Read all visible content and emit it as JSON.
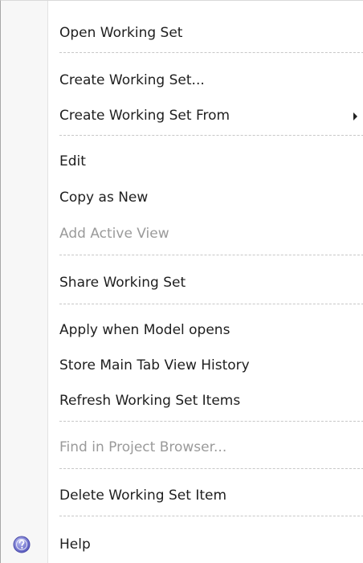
{
  "context_menu": {
    "items": [
      {
        "label": "Open Working Set"
      },
      {
        "label": "Create Working Set..."
      },
      {
        "label": "Create Working Set From"
      },
      {
        "label": "Edit"
      },
      {
        "label": "Copy as New"
      },
      {
        "label": "Add Active View"
      },
      {
        "label": "Share Working Set"
      },
      {
        "label": "Apply when Model opens"
      },
      {
        "label": "Store Main Tab View History"
      },
      {
        "label": "Refresh Working Set Items"
      },
      {
        "label": "Find in Project Browser..."
      },
      {
        "label": "Delete Working Set Item"
      },
      {
        "label": "Help"
      }
    ],
    "icons": {
      "help": "help-icon",
      "submenu": "submenu-arrow-icon"
    },
    "colors": {
      "text": "#1e1e1e",
      "disabled_text": "#9a9a9a",
      "help_icon": "#6d6fc7"
    }
  }
}
